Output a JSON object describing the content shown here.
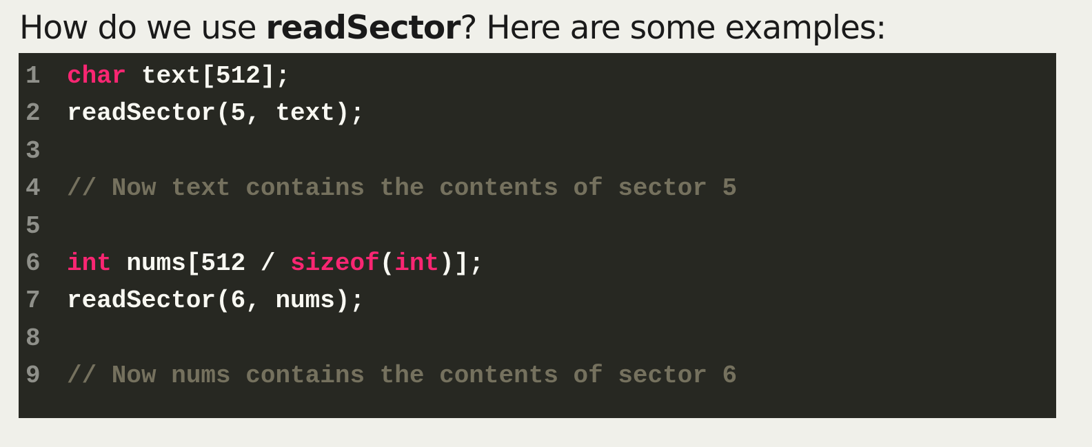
{
  "heading": {
    "prefix": "How do we use ",
    "emphasis": "readSector",
    "suffix": "?  Here are some examples:"
  },
  "code": {
    "theme_colors": {
      "background": "#272822",
      "plain": "#f8f8f2",
      "keyword": "#f92672",
      "comment": "#75715e",
      "line_number": "#8f908a"
    },
    "lines": [
      {
        "number": "1",
        "tokens": [
          {
            "type": "keyword",
            "text": "char"
          },
          {
            "type": "plain",
            "text": " text[512];"
          }
        ]
      },
      {
        "number": "2",
        "tokens": [
          {
            "type": "plain",
            "text": "readSector(5, text);"
          }
        ]
      },
      {
        "number": "3",
        "tokens": []
      },
      {
        "number": "4",
        "tokens": [
          {
            "type": "comment",
            "text": "// Now text contains the contents of sector 5"
          }
        ]
      },
      {
        "number": "5",
        "tokens": []
      },
      {
        "number": "6",
        "tokens": [
          {
            "type": "keyword",
            "text": "int"
          },
          {
            "type": "plain",
            "text": " nums[512 / "
          },
          {
            "type": "keyword",
            "text": "sizeof"
          },
          {
            "type": "plain",
            "text": "("
          },
          {
            "type": "keyword",
            "text": "int"
          },
          {
            "type": "plain",
            "text": ")];"
          }
        ]
      },
      {
        "number": "7",
        "tokens": [
          {
            "type": "plain",
            "text": "readSector(6, nums);"
          }
        ]
      },
      {
        "number": "8",
        "tokens": []
      },
      {
        "number": "9",
        "tokens": [
          {
            "type": "comment",
            "text": "// Now nums contains the contents of sector 6"
          }
        ]
      }
    ]
  }
}
